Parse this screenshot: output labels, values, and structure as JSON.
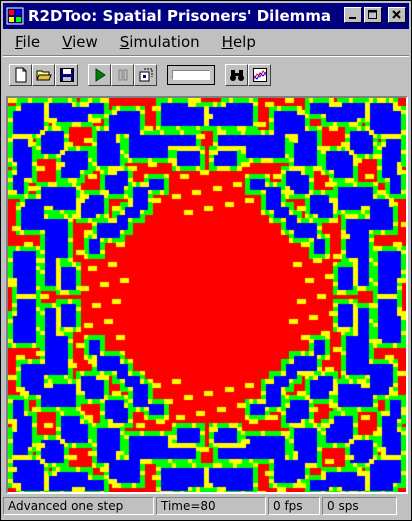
{
  "window": {
    "title": "R2DToo: Spatial Prisoners' Dilemma",
    "title_bg": "#000080"
  },
  "menu": [
    {
      "label": "File",
      "accel": "F",
      "rest": "ile"
    },
    {
      "label": "View",
      "accel": "V",
      "rest": "iew"
    },
    {
      "label": "Simulation",
      "accel": "S",
      "rest": "imulation"
    },
    {
      "label": "Help",
      "accel": "H",
      "rest": "elp"
    }
  ],
  "toolbar": {
    "items": [
      "new-icon",
      "open-icon",
      "save-icon",
      "play-icon",
      "pause-icon",
      "step-icon",
      "speed-slider",
      "binoculars-icon",
      "graph-icon"
    ]
  },
  "grid": {
    "colors": {
      "cooperator": "#0000ff",
      "defector": "#ff0000",
      "new_cooperator": "#00ff00",
      "new_defector": "#ffff00"
    }
  },
  "status": {
    "message": "Advanced one step",
    "time": "Time=80",
    "fps": "0 fps",
    "sps": "0 sps"
  }
}
